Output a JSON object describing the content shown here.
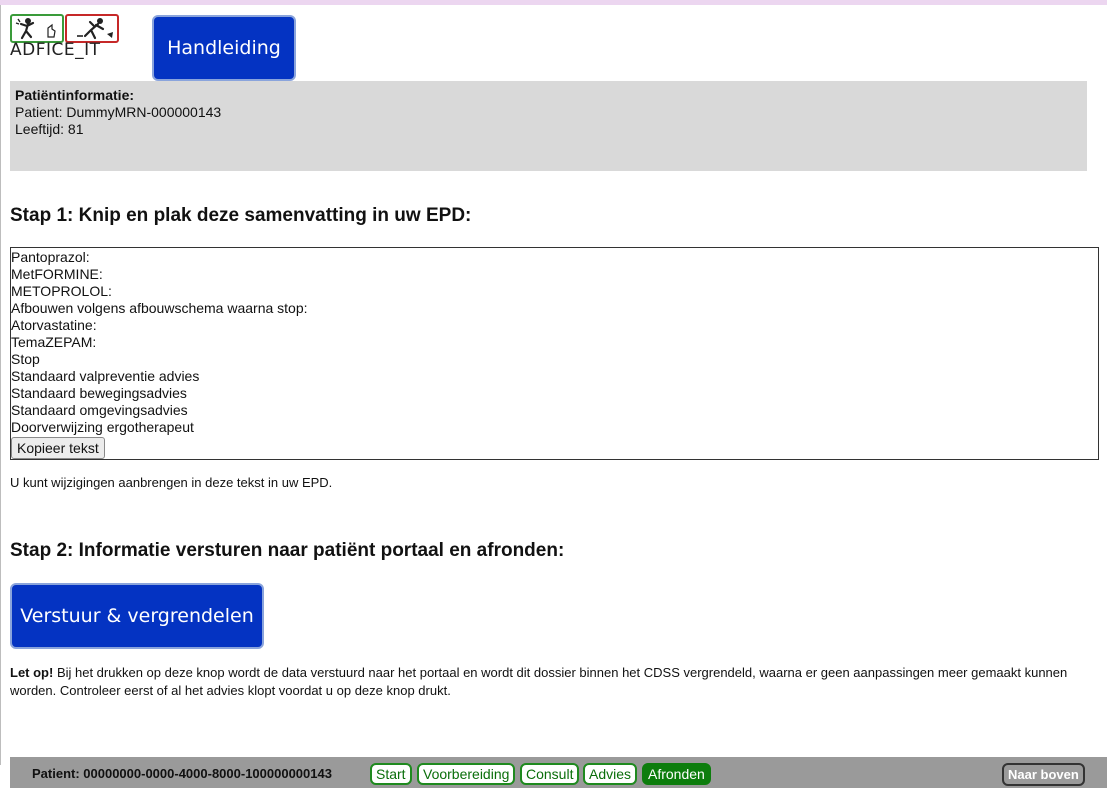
{
  "logo": {
    "text": "ADFICE_IT"
  },
  "header": {
    "manual_label": "Handleiding"
  },
  "patient_info": {
    "title": "Patiëntinformatie:",
    "patient_line": "Patient: DummyMRN-000000143",
    "age_line": "Leeftijd: 81"
  },
  "step1": {
    "title": "Stap 1: Knip en plak deze samenvatting in uw EPD:",
    "summary_lines": [
      "Pantoprazol:",
      "MetFORMINE:",
      "METOPROLOL:",
      "Afbouwen volgens afbouwschema waarna stop:",
      "Atorvastatine:",
      "TemaZEPAM:",
      "Stop",
      "Standaard valpreventie advies",
      "Standaard bewegingsadvies",
      "Standaard omgevingsadvies",
      "Doorverwijzing ergotherapeut"
    ],
    "copy_label": "Kopieer tekst",
    "edit_note": "U kunt wijzigingen aanbrengen in deze tekst in uw EPD."
  },
  "step2": {
    "title": "Stap 2: Informatie versturen naar patiënt portaal en afronden:",
    "send_label": "Verstuur & vergrendelen",
    "warning_bold": "Let op!",
    "warning_text": " Bij het drukken op deze knop wordt de data verstuurd naar het portaal en wordt dit dossier binnen het CDSS vergrendeld, waarna er geen aanpassingen meer gemaakt kunnen worden. Controleer eerst of al het advies klopt voordat u op deze knop drukt."
  },
  "bottom_bar": {
    "patient_id": "Patient: 00000000-0000-4000-8000-100000000143",
    "nav": {
      "start": "Start",
      "voorbereiding": "Voorbereiding",
      "consult": "Consult",
      "advies": "Advies",
      "afronden": "Afronden"
    },
    "active_nav": "Afronden",
    "to_top_label": "Naar boven"
  },
  "colors": {
    "primary_button": "#0433c2",
    "nav_active": "#0d7d0d",
    "nav_border": "#1f8a1f",
    "info_background": "#d9d9d9",
    "bottom_bar": "#9a9a9a"
  }
}
